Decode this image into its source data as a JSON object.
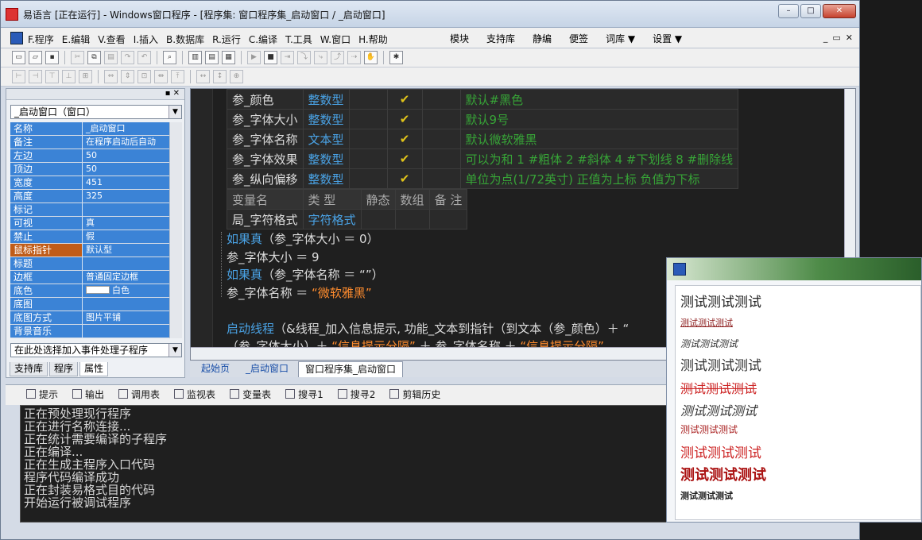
{
  "window": {
    "title": "易语言 [正在运行] - Windows窗口程序 - [程序集: 窗口程序集_启动窗口 / _启动窗口]",
    "min": "–",
    "max": "□",
    "close": "✕"
  },
  "menu": {
    "items": [
      "F.程序",
      "E.编辑",
      "V.查看",
      "I.插入",
      "B.数据库",
      "R.运行",
      "C.编译",
      "T.工具",
      "W.窗口",
      "H.帮助"
    ],
    "right": [
      "模块",
      "支持库",
      "静编",
      "便签",
      "词库 ▼",
      "设置 ▼"
    ],
    "mdi": [
      "_",
      "▭",
      "✕"
    ]
  },
  "props": {
    "header_close": "▪ ✕",
    "object": "_启动窗口（窗口）",
    "rows": [
      {
        "k": "名称",
        "v": "_启动窗口"
      },
      {
        "k": "备注",
        "v": "在程序启动后自动"
      },
      {
        "k": "左边",
        "v": "50"
      },
      {
        "k": "顶边",
        "v": "50"
      },
      {
        "k": "宽度",
        "v": "451"
      },
      {
        "k": "高度",
        "v": "325"
      },
      {
        "k": "标记",
        "v": ""
      },
      {
        "k": "可视",
        "v": "真"
      },
      {
        "k": "禁止",
        "v": "假"
      },
      {
        "k": "鼠标指针",
        "v": "默认型"
      },
      {
        "k": "标题",
        "v": ""
      },
      {
        "k": "边框",
        "v": "普通固定边框"
      },
      {
        "k": "底色",
        "v": "白色"
      },
      {
        "k": "底图",
        "v": ""
      },
      {
        "k": " 底图方式",
        "v": "图片平铺"
      },
      {
        "k": "背景音乐",
        "v": ""
      }
    ],
    "event_combo": "在此处选择加入事件处理子程序",
    "tabs": [
      "支持库",
      "程序",
      "属性"
    ]
  },
  "code": {
    "params": [
      {
        "name": "参_颜色",
        "type": "整数型",
        "check": "✔",
        "note": "默认#黑色"
      },
      {
        "name": "参_字体大小",
        "type": "整数型",
        "check": "✔",
        "note": "默认9号"
      },
      {
        "name": "参_字体名称",
        "type": "文本型",
        "check": "✔",
        "note": "默认微软雅黑"
      },
      {
        "name": "参_字体效果",
        "type": "整数型",
        "check": "✔",
        "note": "可以为和 1 #粗体 2 #斜体 4 #下划线 8 #删除线"
      },
      {
        "name": "参_纵向偏移",
        "type": "整数型",
        "check": "✔",
        "note": "单位为点(1/72英寸) 正值为上标 负值为下标"
      }
    ],
    "var_headers": [
      "变量名",
      "类 型",
      "静态",
      "数组",
      "备 注"
    ],
    "vars": [
      {
        "name": "局_字符格式",
        "type": "字符格式"
      }
    ],
    "l1": {
      "kw": "如果真",
      "rest": "（参_字体大小 ＝ 0）"
    },
    "l2": "参_字体大小 ＝ 9",
    "l3": {
      "kw": "如果真",
      "rest": "（参_字体名称 ＝ “”）"
    },
    "l4": {
      "a": "参_字体名称 ＝ ",
      "s": "“微软雅黑”"
    },
    "l5": {
      "kw": "启动线程",
      "a": "（&线程_加入信息提示, 功能_文本到指针（到文本（参_颜色）＋ “"
    },
    "l6": {
      "a": "（参_字体大小）＋ ",
      "s1": "“信息提示分隔”",
      "b": " ＋ 参_字体名称 ＋ ",
      "s2": "“信息提示分隔”"
    }
  },
  "doc_tabs": [
    "起始页",
    "_启动窗口",
    "窗口程序集_启动窗口"
  ],
  "out_tabs": [
    "提示",
    "输出",
    "调用表",
    "监视表",
    "变量表",
    "搜寻1",
    "搜寻2",
    "剪辑历史"
  ],
  "output_lines": [
    "正在预处理现行程序",
    "正在进行名称连接...",
    "正在统计需要编译的子程序",
    "正在编译...",
    "正在生成主程序入口代码",
    "程序代码编译成功",
    "正在封装易格式目的代码",
    "开始运行被调试程序"
  ],
  "popup": {
    "lines": [
      {
        "t": "测试测试测试",
        "style": "normal",
        "color": "#222222"
      },
      {
        "t": "测试测试测试",
        "style": "small-underline",
        "color": "#8b1a1a"
      },
      {
        "t": "测试测试测试",
        "style": "small-italic",
        "color": "#333333"
      },
      {
        "t": "测试测试测试",
        "style": "normal",
        "color": "#333333"
      },
      {
        "t": "测试测试测试",
        "style": "strike",
        "color": "#cc2222"
      },
      {
        "t": "测试测试测试",
        "style": "italic",
        "color": "#333333"
      },
      {
        "t": "测试测试测试",
        "style": "small",
        "color": "#aa2222"
      },
      {
        "t": "测试测试测试",
        "style": "normal",
        "color": "#cc2222"
      },
      {
        "t": "测试测试测试",
        "style": "bold-large",
        "color": "#aa1111"
      },
      {
        "t": "测试测试测试",
        "style": "small-bold",
        "color": "#222222"
      }
    ]
  }
}
